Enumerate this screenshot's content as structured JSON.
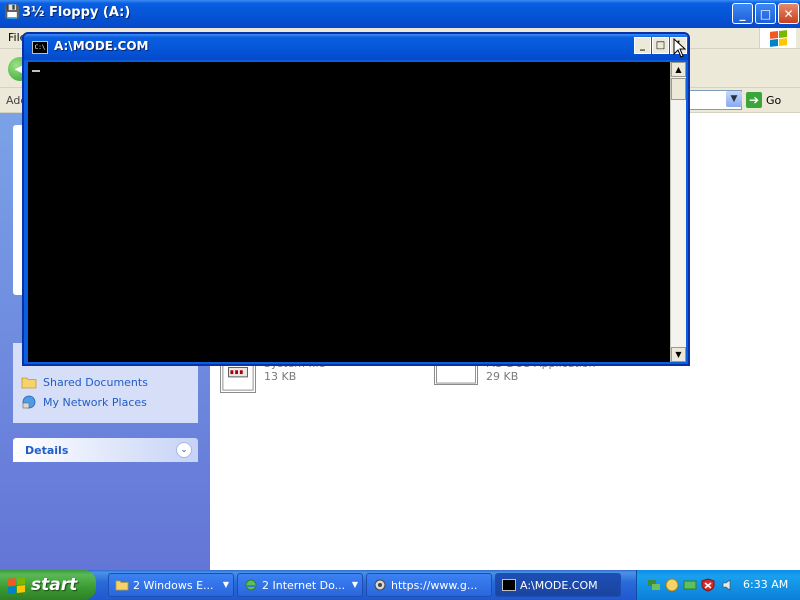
{
  "explorer": {
    "title": "3½ Floppy (A:)",
    "menu_file": "File",
    "address_label": "Address",
    "go_label": "Go",
    "caption": {
      "minimize": "_",
      "maximize": "□",
      "close": "✕"
    }
  },
  "sidebar": {
    "places": [
      {
        "label": "Shared Documents",
        "icon": "folder-icon"
      },
      {
        "label": "My Network Places",
        "icon": "network-icon"
      }
    ],
    "details_title": "Details"
  },
  "content": {
    "files": [
      {
        "type": "System file",
        "size": "13 KB",
        "icon": "system-file-icon"
      },
      {
        "type": "MS-DOS Application",
        "size": "29 KB",
        "icon": "msdos-app-icon"
      }
    ]
  },
  "console": {
    "title": "A:\\MODE.COM",
    "icon_text": "C:\\"
  },
  "taskbar": {
    "start_label": "start",
    "buttons": [
      {
        "label": "2 Windows E...",
        "icon": "folder-icon",
        "grouped": true
      },
      {
        "label": "2 Internet Do...",
        "icon": "ie-icon",
        "grouped": true
      },
      {
        "label": "https://www.g...",
        "icon": "browser-icon",
        "grouped": false
      },
      {
        "label": "A:\\MODE.COM",
        "icon": "console-icon",
        "grouped": false,
        "active": true
      }
    ],
    "clock": "6:33 AM"
  }
}
